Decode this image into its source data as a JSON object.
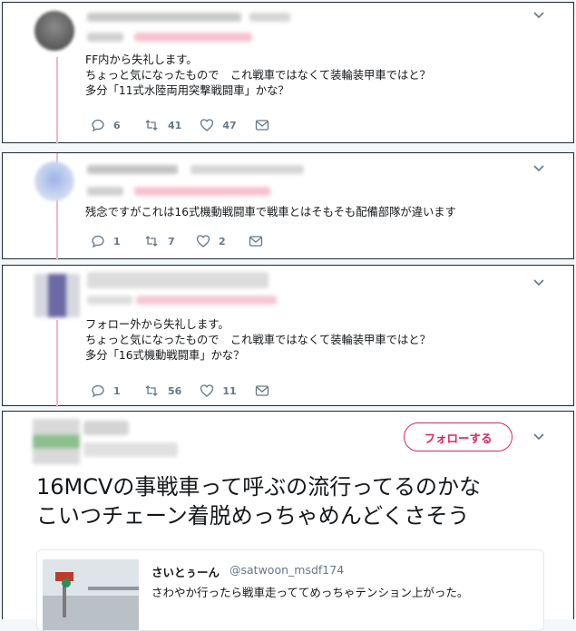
{
  "tweets": [
    {
      "text": "FF内から失礼します。\nちょっと気になったもので　これ戦車ではなくて装輪装甲車ではと？\n多分「11式水陸両用突撃戦闘車」かな？",
      "replies": "6",
      "retweets": "41",
      "likes": "47"
    },
    {
      "text": "残念ですがこれは16式機動戦闘車で戦車とはそもそも配備部隊が違います",
      "replies": "1",
      "retweets": "7",
      "likes": "2"
    },
    {
      "text": "フォロー外から失礼します。\nちょっと気になったもので　これ戦車ではなくて装輪装甲車ではと？\n多分「16式機動戦闘車」かな？",
      "replies": "1",
      "retweets": "56",
      "likes": "11"
    }
  ],
  "main_tweet": {
    "follow_label": "フォローする",
    "text": "16MCVの事戦車って呼ぶの流行ってるのかな\nこいつチェーン着脱めっちゃめんどくさそう",
    "quoted": {
      "name": "さいとぅーん",
      "handle": "@satwoon_msdf174",
      "text": "さわやか行ったら戦車走っててめっちゃテンション上がった。"
    }
  },
  "icons": {
    "reply": "reply-icon",
    "retweet": "retweet-icon",
    "like": "heart-icon",
    "dm": "mail-icon",
    "menu": "chevron-down-icon"
  },
  "colors": {
    "accent": "#e0245e",
    "thread_line": "#f7b5c4",
    "muted": "#657786"
  }
}
